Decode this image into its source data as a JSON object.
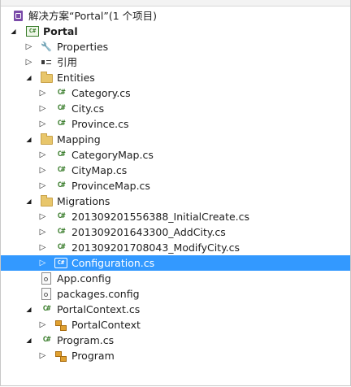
{
  "solution": {
    "label": "解决方案“Portal”(1 个项目)"
  },
  "project": {
    "label": "Portal"
  },
  "properties": {
    "label": "Properties"
  },
  "references": {
    "label": "引用"
  },
  "entities": {
    "label": "Entities",
    "items": [
      {
        "label": "Category.cs"
      },
      {
        "label": "City.cs"
      },
      {
        "label": "Province.cs"
      }
    ]
  },
  "mapping": {
    "label": "Mapping",
    "items": [
      {
        "label": "CategoryMap.cs"
      },
      {
        "label": "CityMap.cs"
      },
      {
        "label": "ProvinceMap.cs"
      }
    ]
  },
  "migrations": {
    "label": "Migrations",
    "items": [
      {
        "label": "201309201556388_InitialCreate.cs"
      },
      {
        "label": "201309201643300_AddCity.cs"
      },
      {
        "label": "201309201708043_ModifyCity.cs"
      },
      {
        "label": "Configuration.cs"
      }
    ]
  },
  "app_config": {
    "label": "App.config"
  },
  "packages_config": {
    "label": "packages.config"
  },
  "portal_context_file": {
    "label": "PortalContext.cs"
  },
  "portal_context_class": {
    "label": "PortalContext"
  },
  "program_file": {
    "label": "Program.cs"
  },
  "program_class": {
    "label": "Program"
  },
  "colors": {
    "selection": "#3399ff",
    "csharp_green": "#3a7d2c",
    "folder": "#e8c66b"
  }
}
